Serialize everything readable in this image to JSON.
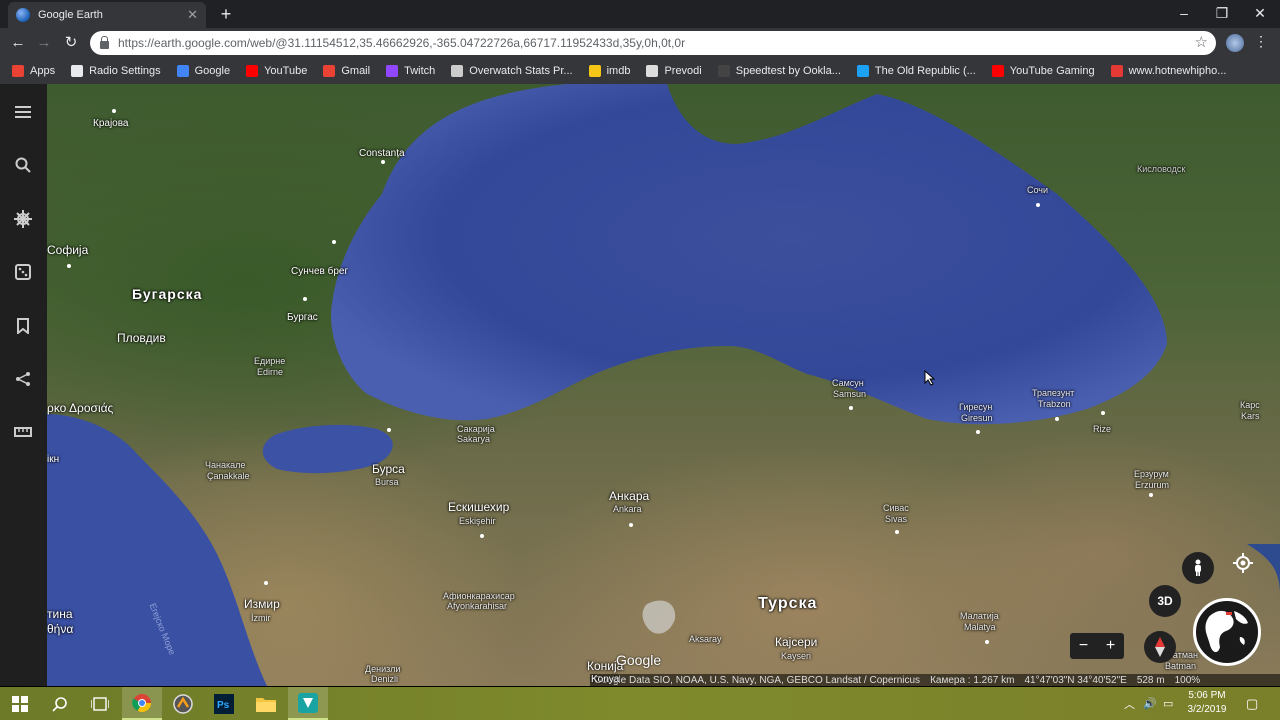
{
  "browser": {
    "tab_title": "Google Earth",
    "url": "https://earth.google.com/web/@31.11154512,35.46662926,-365.04722726a,66717.11952433d,35y,0h,0t,0r",
    "bookmarks": [
      {
        "label": "Apps",
        "icon": "apps-grid-icon",
        "color": "#ea4335"
      },
      {
        "label": "Radio Settings",
        "icon": "page-icon",
        "color": "#e8eaed"
      },
      {
        "label": "Google",
        "icon": "google-icon",
        "color": "#4285f4"
      },
      {
        "label": "YouTube",
        "icon": "youtube-icon",
        "color": "#ff0000"
      },
      {
        "label": "Gmail",
        "icon": "gmail-icon",
        "color": "#ea4335"
      },
      {
        "label": "Twitch",
        "icon": "twitch-icon",
        "color": "#9146ff"
      },
      {
        "label": "Overwatch Stats Pr...",
        "icon": "overwatch-icon",
        "color": "#cccccc"
      },
      {
        "label": "imdb",
        "icon": "imdb-icon",
        "color": "#f5c518"
      },
      {
        "label": "Prevodi",
        "icon": "prevodi-icon",
        "color": "#dddddd"
      },
      {
        "label": "Speedtest by Ookla...",
        "icon": "speedtest-icon",
        "color": "#444444"
      },
      {
        "label": "The Old Republic (...",
        "icon": "twitter-icon",
        "color": "#1da1f2"
      },
      {
        "label": "YouTube Gaming",
        "icon": "youtube-gaming-icon",
        "color": "#ff0000"
      },
      {
        "label": "www.hotnewhipho...",
        "icon": "hotnewhiphop-icon",
        "color": "#e53935"
      }
    ]
  },
  "map": {
    "labels": {
      "krajova": "Крајова",
      "constanta": "Constanța",
      "sofija": "Софија",
      "bugarska": "Бугарска",
      "sunchev_breg": "Сунчев брег",
      "burgas": "Бургас",
      "plovdiv": "Пловдив",
      "edirne": "Едирне",
      "edirne_latin": "Edirne",
      "drosias": "ρκο Δροσιάς",
      "ikh": "ікн",
      "chanakale": "Чанакале",
      "canakkale": "Çanakkale",
      "sakarija": "Сакарија",
      "sakarya": "Sakarya",
      "bursa_cyr": "Бурса",
      "bursa": "Bursa",
      "eskishehir": "Ескишехир",
      "eskisehir": "Eskişehir",
      "ankara_cyr": "Анкара",
      "ankara": "Ankara",
      "samsun_cyr": "Самсун",
      "samsun": "Samsun",
      "giresun_cyr": "Гиресун",
      "giresun": "Giresun",
      "trabzon_cyr": "Трапезунт",
      "trabzon": "Trabzon",
      "rize": "Rize",
      "sochi": "Сочи",
      "kislovodsk": "Кисловодск",
      "kars_cyr": "Карс",
      "kars": "Kars",
      "erzurum_cyr": "Ерзурум",
      "erzurum": "Erzurum",
      "sivas_cyr": "Сивас",
      "sivas": "Sivas",
      "afyon_cyr": "Афионкарахисар",
      "afyon": "Afyonkarahisar",
      "izmir_cyr": "Измир",
      "izmir": "İzmir",
      "turska": "Турска",
      "aksaray": "Aksaray",
      "kajseri": "Кајсери",
      "kayseri": "Kayseri",
      "malatija": "Малатија",
      "malatya": "Malatya",
      "batman_cyr": "Батман",
      "batman": "Batman",
      "denizli_cyr": "Денизли",
      "denizli": "Denizli",
      "konja": "Конија",
      "konya": "Konya",
      "tina": "тина",
      "thina": "θήνα",
      "egejsko": "Егејско Море"
    },
    "google_logo": "Google",
    "attribution": "Google Data SIO, NOAA, U.S. Navy, NGA, GEBCO Landsat / Copernicus",
    "camera": "Камера : 1.267 km",
    "coords": "41°47'03\"N 34°40'52\"E",
    "elevation": "528 m",
    "zoom_pct": "100%",
    "btn_3d": "3D"
  },
  "taskbar": {
    "time": "5:06 PM",
    "date": "3/2/2019",
    "accent": "#7f8a2c"
  }
}
